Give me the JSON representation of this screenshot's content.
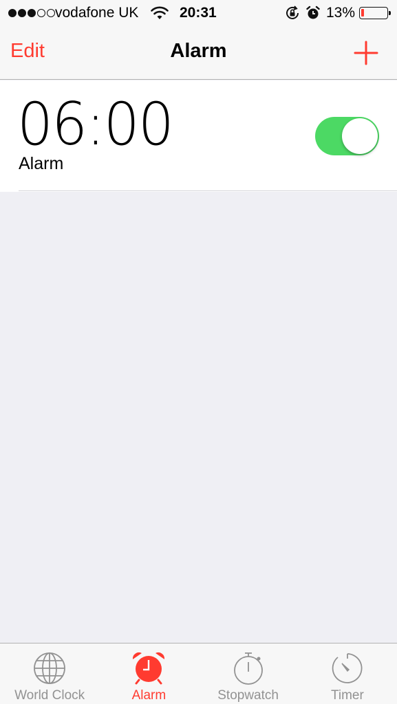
{
  "status_bar": {
    "signal_dots": [
      "filled",
      "filled",
      "filled",
      "empty",
      "empty"
    ],
    "carrier": "vodafone UK",
    "time": "20:31",
    "battery_percent": "13%",
    "battery_level": 0.13,
    "battery_color": "#ff3b30",
    "icons": [
      "wifi-icon",
      "rotation-lock-icon",
      "alarm-icon",
      "battery-icon"
    ]
  },
  "nav_bar": {
    "edit_label": "Edit",
    "title": "Alarm",
    "add_icon": "plus-icon"
  },
  "alarms": [
    {
      "time": "06:00",
      "label": "Alarm",
      "enabled": true
    }
  ],
  "colors": {
    "accent": "#ff3b30",
    "toggle_on": "#4cd964",
    "tab_inactive": "#929292",
    "background": "#efeff4"
  },
  "tab_bar": {
    "tabs": [
      {
        "label": "World Clock",
        "icon": "globe-icon",
        "active": false
      },
      {
        "label": "Alarm",
        "icon": "alarm-clock-icon",
        "active": true
      },
      {
        "label": "Stopwatch",
        "icon": "stopwatch-icon",
        "active": false
      },
      {
        "label": "Timer",
        "icon": "timer-icon",
        "active": false
      }
    ]
  }
}
